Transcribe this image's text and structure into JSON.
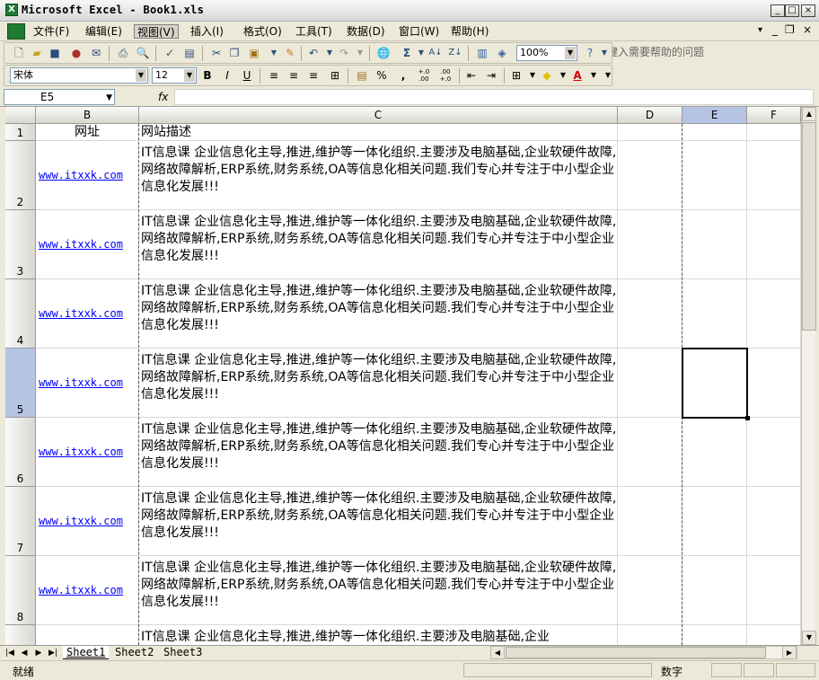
{
  "window": {
    "title": "Microsoft Excel - Book1.xls",
    "app_icon": "X",
    "buttons": [
      "_",
      "□",
      "×"
    ]
  },
  "menu": {
    "items": [
      "文件(F)",
      "编辑(E)",
      "视图(V)",
      "插入(I)",
      "格式(O)",
      "工具(T)",
      "数据(D)",
      "窗口(W)",
      "帮助(H)"
    ],
    "active_index": 2,
    "help_placeholder": "键入需要帮助的问题",
    "doc_controls": [
      "▾",
      "_",
      "❐",
      "×"
    ]
  },
  "toolbar": {
    "zoom": "100%",
    "font_name": "宋体",
    "font_size": "12",
    "bold": "B",
    "italic": "I",
    "underline": "U",
    "percent": "%",
    "comma": ",",
    "inc_decimal": "+.0 .00",
    "dec_decimal": ".00 +.0"
  },
  "formula_bar": {
    "name_box": "E5",
    "fx_label": "fx",
    "value": ""
  },
  "grid": {
    "columns": [
      "B",
      "C",
      "D",
      "E",
      "F"
    ],
    "selected_column": "E",
    "rows": [
      {
        "num": "1",
        "b": "网址",
        "c": "网站描述"
      },
      {
        "num": "2",
        "b": "www.itxxk.com",
        "c": "IT信息课 企业信息化主导,推进,维护等一体化组织.主要涉及电脑基础,企业软硬件故障,网络故障解析,ERP系统,财务系统,OA等信息化相关问题.我们专心并专注于中小型企业信息化发展!!!"
      },
      {
        "num": "3",
        "b": "www.itxxk.com",
        "c": "IT信息课 企业信息化主导,推进,维护等一体化组织.主要涉及电脑基础,企业软硬件故障,网络故障解析,ERP系统,财务系统,OA等信息化相关问题.我们专心并专注于中小型企业信息化发展!!!"
      },
      {
        "num": "4",
        "b": "www.itxxk.com",
        "c": "IT信息课 企业信息化主导,推进,维护等一体化组织.主要涉及电脑基础,企业软硬件故障,网络故障解析,ERP系统,财务系统,OA等信息化相关问题.我们专心并专注于中小型企业信息化发展!!!"
      },
      {
        "num": "5",
        "b": "www.itxxk.com",
        "c": "IT信息课 企业信息化主导,推进,维护等一体化组织.主要涉及电脑基础,企业软硬件故障,网络故障解析,ERP系统,财务系统,OA等信息化相关问题.我们专心并专注于中小型企业信息化发展!!!"
      },
      {
        "num": "6",
        "b": "www.itxxk.com",
        "c": "IT信息课 企业信息化主导,推进,维护等一体化组织.主要涉及电脑基础,企业软硬件故障,网络故障解析,ERP系统,财务系统,OA等信息化相关问题.我们专心并专注于中小型企业信息化发展!!!"
      },
      {
        "num": "7",
        "b": "www.itxxk.com",
        "c": "IT信息课 企业信息化主导,推进,维护等一体化组织.主要涉及电脑基础,企业软硬件故障,网络故障解析,ERP系统,财务系统,OA等信息化相关问题.我们专心并专注于中小型企业信息化发展!!!"
      },
      {
        "num": "8",
        "b": "www.itxxk.com",
        "c": "IT信息课 企业信息化主导,推进,维护等一体化组织.主要涉及电脑基础,企业软硬件故障,网络故障解析,ERP系统,财务系统,OA等信息化相关问题.我们专心并专注于中小型企业信息化发展!!!"
      },
      {
        "num": "",
        "b": "",
        "c": "IT信息课 企业信息化主导,推进,维护等一体化组织.主要涉及电脑基础,企业"
      }
    ],
    "selected_row": "5"
  },
  "sheets": {
    "tabs": [
      "Sheet1",
      "Sheet2",
      "Sheet3"
    ],
    "active_index": 0
  },
  "status": {
    "left": "就绪",
    "mode": "数字"
  }
}
